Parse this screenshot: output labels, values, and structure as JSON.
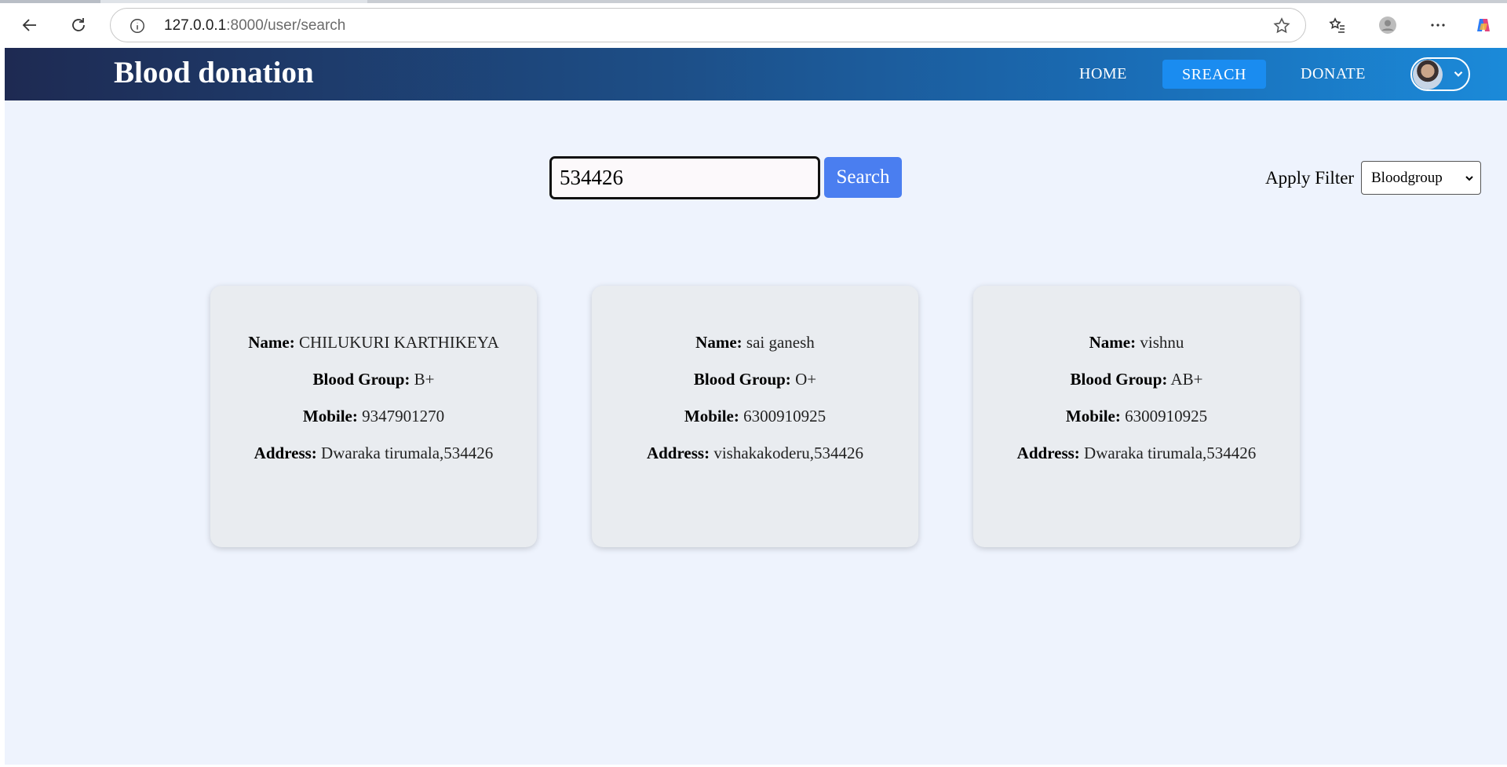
{
  "browser": {
    "url_host": "127.0.0.1",
    "url_path": ":8000/user/search"
  },
  "navbar": {
    "brand": "Blood donation",
    "links": [
      {
        "label": "HOME"
      },
      {
        "label": "SREACH"
      },
      {
        "label": "DONATE"
      }
    ]
  },
  "search": {
    "value": "534426",
    "button_label": "Search"
  },
  "filter": {
    "label": "Apply Filter",
    "selected": "Bloodgroup"
  },
  "field_labels": {
    "name": "Name:",
    "blood_group": "Blood Group:",
    "mobile": "Mobile:",
    "address": "Address:"
  },
  "donors": [
    {
      "name": "CHILUKURI KARTHIKEYA",
      "blood_group": "B+",
      "mobile": "9347901270",
      "address": "Dwaraka tirumala,534426"
    },
    {
      "name": "sai ganesh",
      "blood_group": "O+",
      "mobile": "6300910925",
      "address": "vishakakoderu,534426"
    },
    {
      "name": "vishnu",
      "blood_group": "AB+",
      "mobile": "6300910925",
      "address": "Dwaraka tirumala,534426"
    }
  ]
}
